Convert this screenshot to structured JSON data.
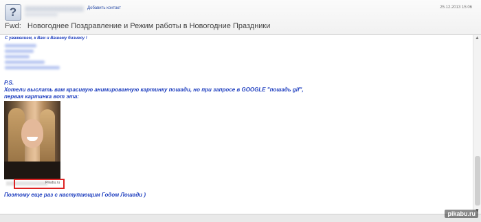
{
  "header": {
    "avatar_glyph": "?",
    "add_contact": "Добавить контакт",
    "timestamp": "25.12.2013 15:06",
    "subject_prefix": "Fwd:",
    "subject": "Новогоднее Поздравление и Режим работы в Новогодние Праздники"
  },
  "body": {
    "closing": "С уважением, к Вам и Вашему бизнесу !",
    "ps_lines": [
      "P.S.",
      "Хотели выслать вам красивую анимированную картинку пошади, но при запросе в GOOGLE \"пошадь gif\",",
      "первая картинка вот эта:"
    ],
    "caption_tail": "Pikabu.ru",
    "final": "Поэтому еще раз с наступающим Годом Лошади )"
  },
  "scrollbar": {
    "up": "▲",
    "down": "▼"
  },
  "watermark": "pikabu.ru"
}
